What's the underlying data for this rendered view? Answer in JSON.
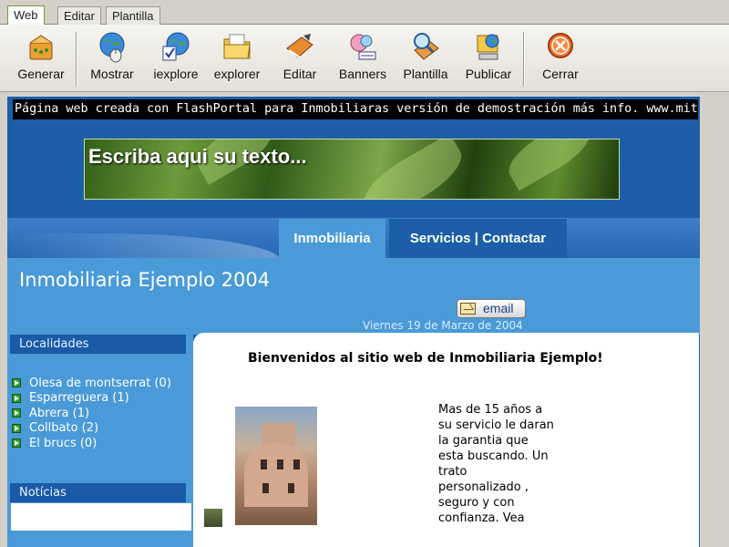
{
  "tabs": [
    "Web",
    "Editar",
    "Plantilla"
  ],
  "toolbar": {
    "buttons": [
      {
        "label": "Generar",
        "icon": "generate-icon"
      },
      {
        "label": "Mostrar",
        "icon": "globe-mouse-icon"
      },
      {
        "label": "iexplore",
        "icon": "globe-check-icon"
      },
      {
        "label": "explorer",
        "icon": "folder-icon"
      },
      {
        "label": "Editar",
        "icon": "edit-book-icon"
      },
      {
        "label": "Banners",
        "icon": "banners-icon"
      },
      {
        "label": "Plantilla",
        "icon": "magnifier-icon"
      },
      {
        "label": "Publicar",
        "icon": "publish-icon"
      },
      {
        "label": "Cerrar",
        "icon": "close-icon"
      }
    ]
  },
  "site": {
    "marquee": "Página web creada con FlashPortal para Inmobiliaras versión de demostración más info. www.mitsoftwa",
    "banner_text": "Escriba aqui su texto...",
    "nav": {
      "tab1": "Inmobiliaria",
      "tab2": "Servicios | Contactar"
    },
    "title": "Inmobiliaria Ejemplo 2004",
    "email_label": "email",
    "date": "Viernes 19 de Marzo de 2004",
    "localidades_header": "Localidades",
    "localidades": [
      "Olesa de montserrat (0)",
      "Esparreguera (1)",
      "Abrera (1)",
      "Collbato (2)",
      "El brucs (0)"
    ],
    "noticias_header": "Notícias",
    "welcome": "Bienvenidos al sitio web de Inmobiliaria Ejemplo!",
    "description": [
      "Mas de 15 años a",
      "su servicio le daran",
      "la garantia que",
      "esta buscando. Un",
      "trato",
      "personalizado ,",
      "seguro y con",
      "confianza. Vea"
    ]
  },
  "colors": {
    "page_bg": "#1c5fa8",
    "light_blue": "#4a9ad8",
    "marquee_bg": "#000000"
  }
}
